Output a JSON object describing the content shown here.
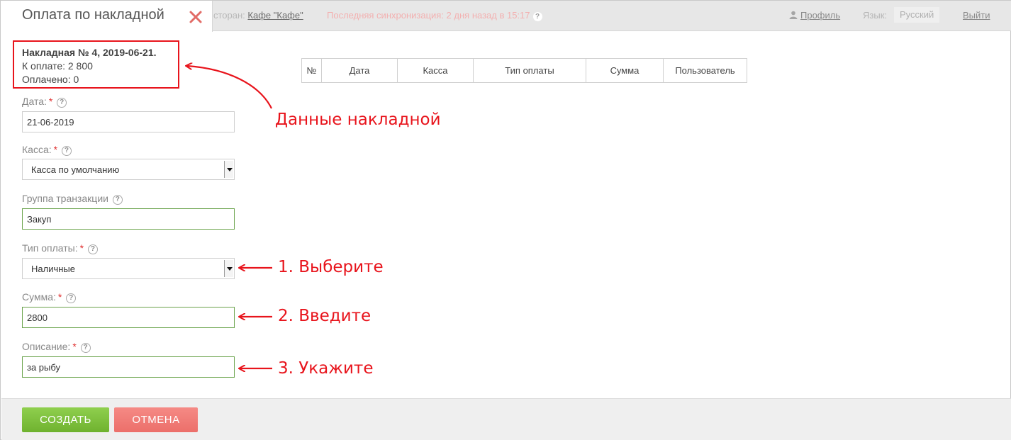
{
  "topbar": {
    "restaurant_prefix": "сторан:",
    "restaurant_name": "Кафе \"Кафе\"",
    "sync_text": "Последняя синхронизация: 2 дня назад в 15:17",
    "profile_label": "Профиль",
    "language_label": "Язык:",
    "language_value": "Русский",
    "logout_label": "Выйти"
  },
  "dialog": {
    "title": "Оплата по накладной"
  },
  "invoice": {
    "title": "Накладная № 4, 2019-06-21.",
    "to_pay": "К оплате: 2 800",
    "paid": "Оплачено: 0"
  },
  "form": {
    "date": {
      "label": "Дата:",
      "value": "21-06-2019"
    },
    "cashbox": {
      "label": "Касса:",
      "value": "Касса по умолчанию"
    },
    "group": {
      "label": "Группа транзакции",
      "value": "Закуп"
    },
    "payment_type": {
      "label": "Тип оплаты:",
      "value": "Наличные"
    },
    "amount": {
      "label": "Сумма:",
      "value": "2800"
    },
    "description": {
      "label": "Описание:",
      "value": "за рыбу"
    },
    "required_mark": "*",
    "help_mark": "?"
  },
  "table": {
    "headers": [
      "№",
      "Дата",
      "Касса",
      "Тип оплаты",
      "Сумма",
      "Пользователь"
    ]
  },
  "annotations": {
    "invoice_data": "Данные накладной",
    "step1": "1. Выберите",
    "step2": "2. Введите",
    "step3": "3. Укажите"
  },
  "buttons": {
    "create": "СОЗДАТЬ",
    "cancel": "ОТМЕНА"
  },
  "colors": {
    "annotation_red": "#e8141c",
    "create_green": "#7cc03c",
    "cancel_red": "#ee7a75",
    "valid_border": "#6aa34b"
  }
}
